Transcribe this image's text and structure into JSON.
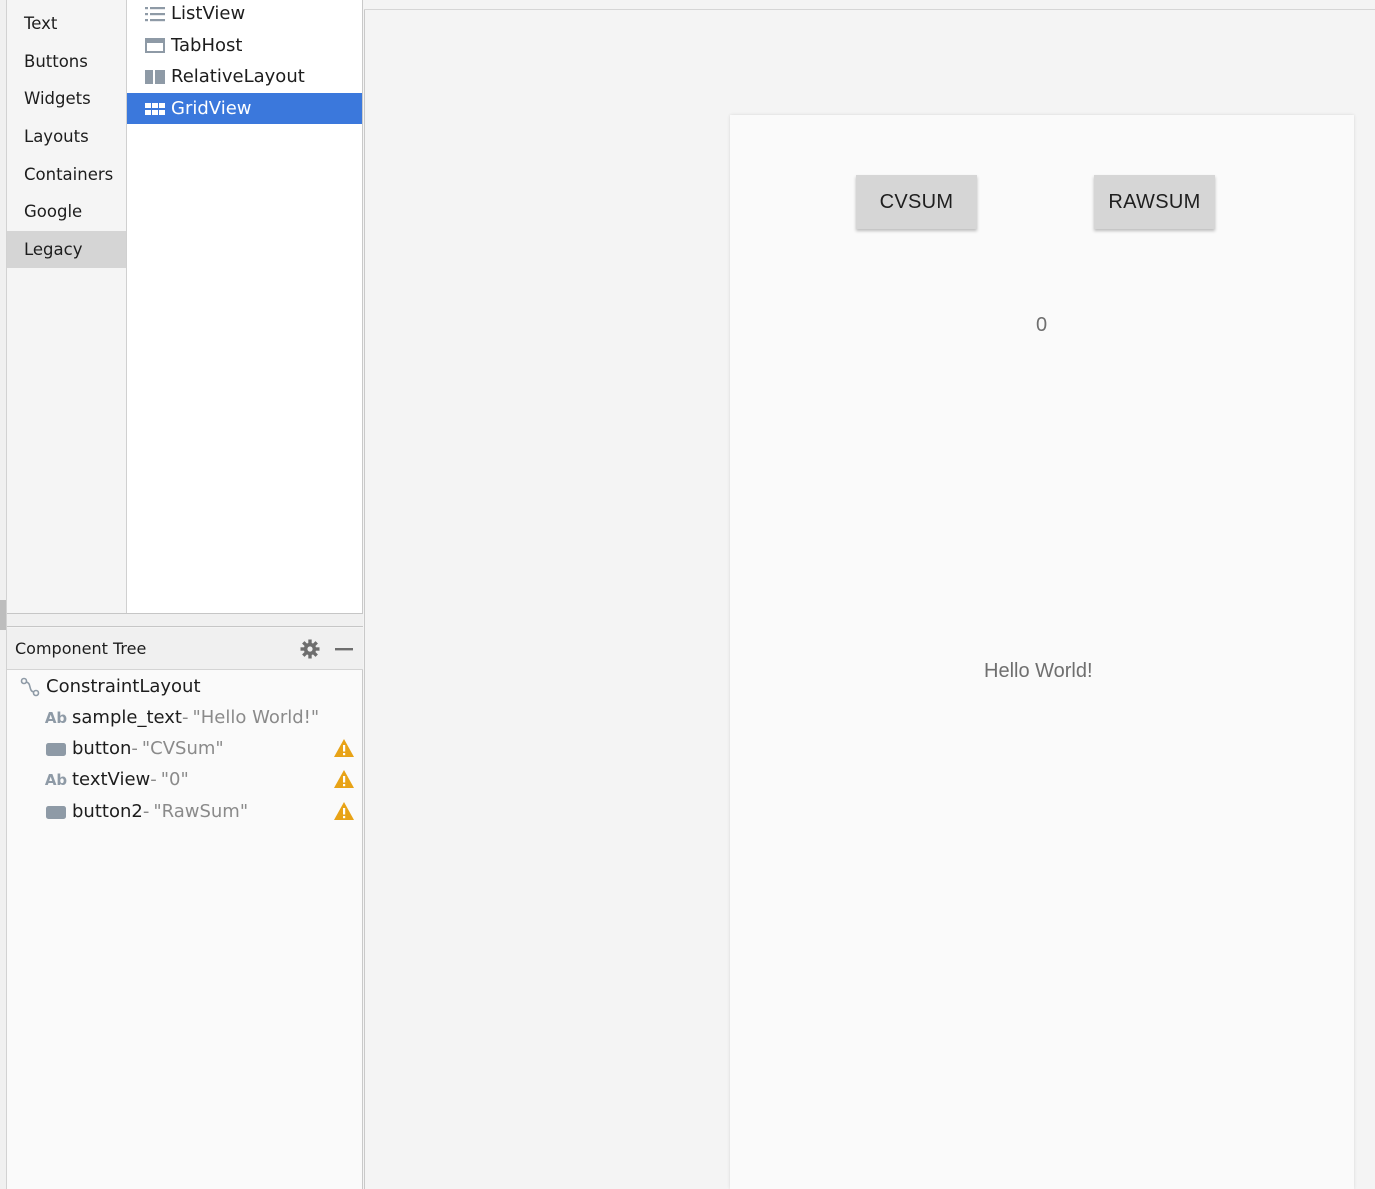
{
  "palette": {
    "categories": [
      "Text",
      "Buttons",
      "Widgets",
      "Layouts",
      "Containers",
      "Google",
      "Legacy"
    ],
    "selected_category": "Legacy",
    "items": [
      {
        "label": "ListView",
        "icon": "list-view-icon"
      },
      {
        "label": "TabHost",
        "icon": "tab-host-icon"
      },
      {
        "label": "RelativeLayout",
        "icon": "relative-layout-icon"
      },
      {
        "label": "GridView",
        "icon": "grid-view-icon"
      }
    ],
    "selected_item": "GridView"
  },
  "component_tree": {
    "title": "Component Tree",
    "root": {
      "label": "ConstraintLayout",
      "icon": "constraint-layout-icon"
    },
    "children": [
      {
        "id": "sample_text",
        "value": "\"Hello World!\"",
        "icon": "Ab",
        "warning": false
      },
      {
        "id": "button",
        "value": "\"CVSum\"",
        "icon": "button-icon",
        "warning": true
      },
      {
        "id": "textView",
        "value": "\"0\"",
        "icon": "Ab",
        "warning": true
      },
      {
        "id": "button2",
        "value": "\"RawSum\"",
        "icon": "button-icon",
        "warning": true
      }
    ],
    "separator": "-",
    "colors": {
      "warning": "#e8a317",
      "selection": "#3b78dc"
    }
  },
  "preview": {
    "button_left": "CVSUM",
    "button_right": "RAWSUM",
    "number_text": "0",
    "hello_text": "Hello World!"
  }
}
